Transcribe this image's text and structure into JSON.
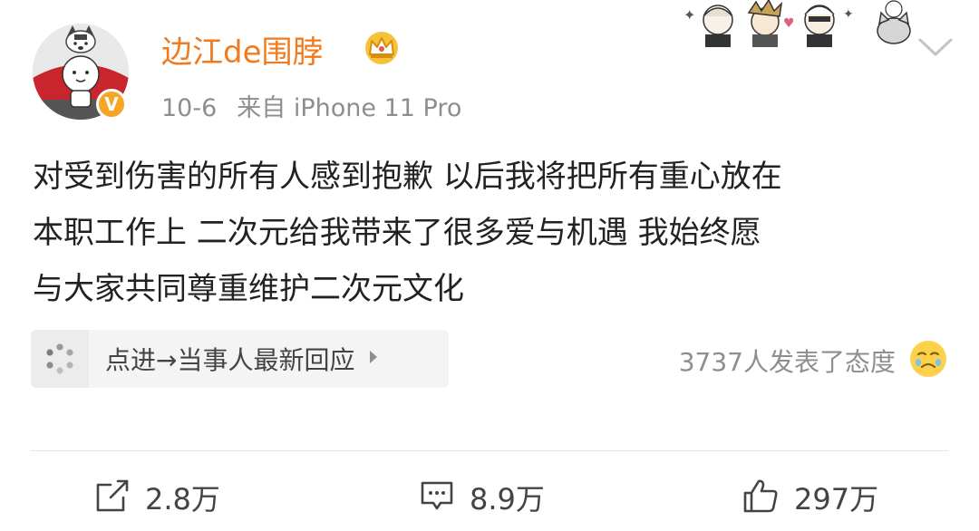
{
  "post": {
    "username": "边江de围脖",
    "date": "10-6",
    "source": "来自 iPhone 11 Pro",
    "verified_mark": "V",
    "content_lines": [
      "对受到伤害的所有人感到抱歉 以后我将把所有重心放在",
      "本职工作上  二次元给我带来了很多爱与机遇 我始终愿",
      "与大家共同尊重维护二次元文化"
    ],
    "topic_label": "点进→当事人最新回应",
    "reactions_text": "3737人发表了态度"
  },
  "actions": {
    "share_count": "2.8万",
    "comment_count": "8.9万",
    "like_count": "297万"
  },
  "icons": {
    "avatar": "husky-cartoon-avatar",
    "verified": "verified-badge-icon",
    "crown": "crown-icon",
    "stickers": "anime-sticker-decoration",
    "menu": "chevron-down-icon",
    "topic": "topic-spinner-icon",
    "topic_arrow": "triangle-right-icon",
    "reaction": "sad-emoji-icon",
    "share": "share-icon",
    "comment": "comment-icon",
    "like": "thumbs-up-icon"
  },
  "colors": {
    "username": "#f07b1f",
    "verified": "#f5a623",
    "meta": "#8e8e8e",
    "text": "#222222"
  }
}
